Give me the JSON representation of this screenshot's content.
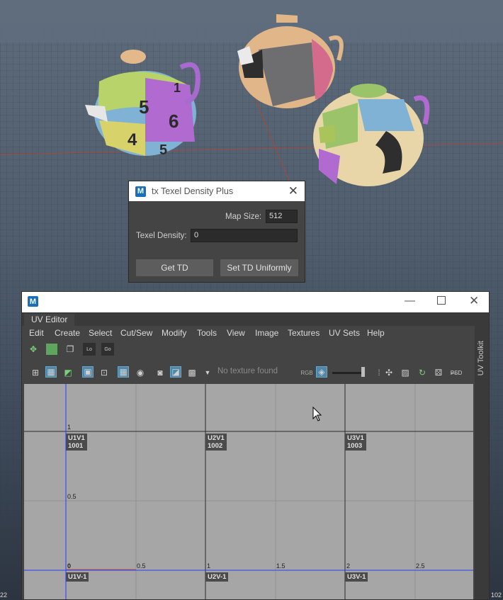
{
  "td_dialog": {
    "logo": "M",
    "title": "tx Texel Density Plus",
    "map_size_label": "Map Size:",
    "map_size_value": "512",
    "texel_density_label": "Texel Density:",
    "texel_density_value": "0",
    "get_td_label": "Get TD",
    "set_td_uniformly_label": "Set TD Uniformly",
    "close_icon": "close-icon"
  },
  "uv_editor": {
    "logo": "M",
    "tab": "UV Editor",
    "menus": [
      "Edit",
      "Create",
      "Select",
      "Cut/Sew",
      "Modify",
      "Tools",
      "View",
      "Image",
      "Textures",
      "UV Sets",
      "Help"
    ],
    "texture_status": "No texture found",
    "rgb_label": "RGB",
    "psd_label": "PSD",
    "toolkit_label": "UV Toolkit",
    "lo_label": "Lo",
    "go_label": "Go",
    "tiles": [
      {
        "name": "U1V1",
        "id": "1001"
      },
      {
        "name": "U2V1",
        "id": "1002"
      },
      {
        "name": "U3V1",
        "id": "1003"
      },
      {
        "name": "U1V-1",
        "id": ""
      },
      {
        "name": "U2V-1",
        "id": ""
      },
      {
        "name": "U3V-1",
        "id": ""
      }
    ],
    "axis_labels": {
      "v1": "1",
      "v05": "0.5",
      "origin": "0",
      "u05": "0.5",
      "u1": "1",
      "u15": "1.5",
      "u2": "2",
      "u25": "2.5"
    }
  },
  "viewport": {
    "left_edge_text": "22",
    "right_edge_text": "102",
    "teapot_numbers": [
      "5",
      "6",
      "4",
      "5",
      "1"
    ]
  },
  "colors": {
    "maya_blue": "#1b6fb6",
    "uv_axis_blue": "#2b3cff",
    "grid_red_line": "#a24a3c",
    "active_icon": "#4f87a8"
  }
}
